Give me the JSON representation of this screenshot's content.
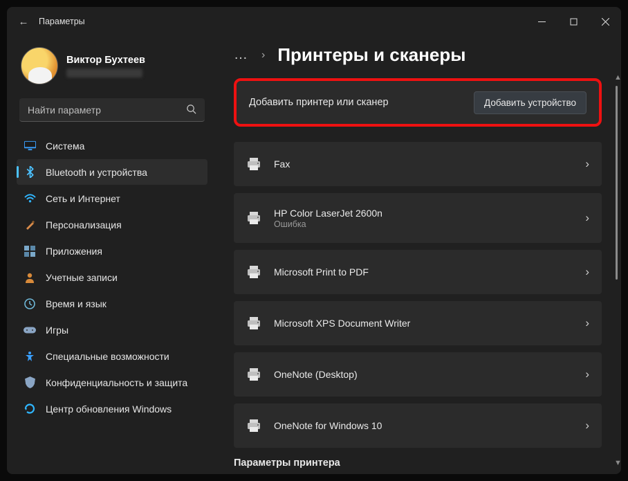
{
  "window": {
    "title": "Параметры"
  },
  "profile": {
    "name": "Виктор Бухтеев"
  },
  "search": {
    "placeholder": "Найти параметр"
  },
  "nav": {
    "items": [
      {
        "label": "Система",
        "icon": "monitor",
        "color": "#3aa0ff"
      },
      {
        "label": "Bluetooth и устройства",
        "icon": "bluetooth",
        "color": "#3aa0ff",
        "active": true
      },
      {
        "label": "Сеть и Интернет",
        "icon": "wifi",
        "color": "#2fb6ff"
      },
      {
        "label": "Персонализация",
        "icon": "brush",
        "color": "#d98b4a"
      },
      {
        "label": "Приложения",
        "icon": "apps",
        "color": "#7aa8c9"
      },
      {
        "label": "Учетные записи",
        "icon": "person",
        "color": "#d88a3a"
      },
      {
        "label": "Время и язык",
        "icon": "clock",
        "color": "#6fb8d8"
      },
      {
        "label": "Игры",
        "icon": "gamepad",
        "color": "#8aa5c4"
      },
      {
        "label": "Специальные возможности",
        "icon": "accessibility",
        "color": "#3aa0ff"
      },
      {
        "label": "Конфиденциальность и защита",
        "icon": "shield",
        "color": "#8aa5c4"
      },
      {
        "label": "Центр обновления Windows",
        "icon": "update",
        "color": "#2fb6ff"
      }
    ]
  },
  "page": {
    "title": "Принтеры и сканеры",
    "add_label": "Добавить принтер или сканер",
    "add_button": "Добавить устройство",
    "section_header": "Параметры принтера"
  },
  "printers": [
    {
      "name": "Fax",
      "status": ""
    },
    {
      "name": "HP Color LaserJet 2600n",
      "status": "Ошибка"
    },
    {
      "name": "Microsoft Print to PDF",
      "status": ""
    },
    {
      "name": "Microsoft XPS Document Writer",
      "status": ""
    },
    {
      "name": "OneNote (Desktop)",
      "status": ""
    },
    {
      "name": "OneNote for Windows 10",
      "status": ""
    }
  ]
}
